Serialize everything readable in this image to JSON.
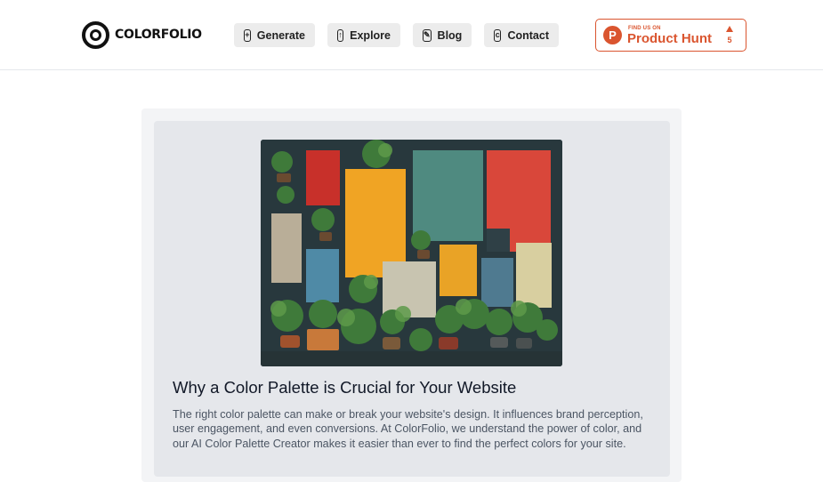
{
  "header": {
    "brand": "COLORFOLIO",
    "nav": [
      {
        "label": "Generate",
        "icon": "plus-square-icon",
        "glyph": "+"
      },
      {
        "label": "Explore",
        "icon": "arrow-up-square-icon",
        "glyph": "↑"
      },
      {
        "label": "Blog",
        "icon": "edit-square-icon",
        "glyph": "✎"
      },
      {
        "label": "Contact",
        "icon": "contact-square-icon",
        "glyph": "c"
      }
    ],
    "product_hunt": {
      "letter": "P",
      "small_text": "FIND US ON",
      "big_text": "Product Hunt",
      "upvotes": "5"
    }
  },
  "article": {
    "image_alt": "Colorful painted panels with potted plants on a dark wall",
    "title": "Why a Color Palette is Crucial for Your Website",
    "body": "The right color palette can make or break your website's design. It influences brand perception, user engagement, and even conversions. At ColorFolio, we understand the power of color, and our AI Color Palette Creator makes it easier than ever to find the perfect colors for your site."
  },
  "colors": {
    "brand_orange": "#da552f",
    "nav_bg": "#ececec",
    "card_outer": "#f3f4f6",
    "card_inner": "#e5e7eb",
    "hero_bg": "#2b3a3f"
  }
}
